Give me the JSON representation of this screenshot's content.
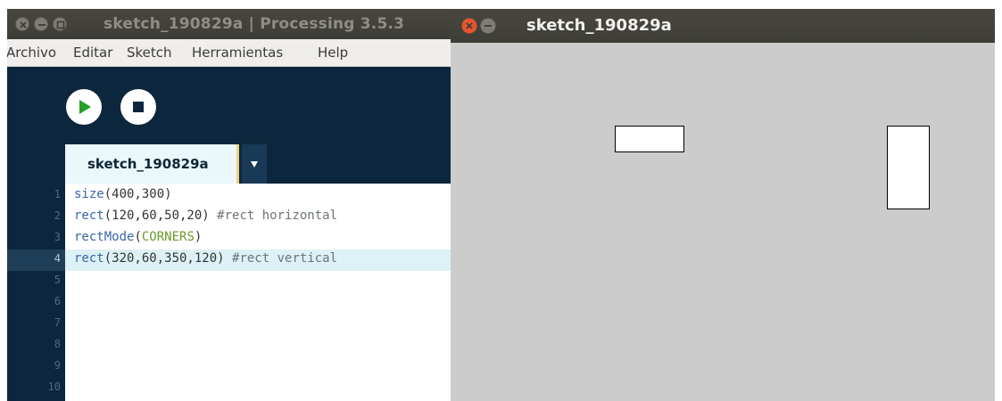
{
  "ide": {
    "title": "sketch_190829a | Processing 3.5.3",
    "menu": [
      "Archivo",
      "Editar",
      "Sketch",
      "Herramientas",
      "Help"
    ],
    "tab_label": "sketch_190829a",
    "tab_menu_glyph": "▾",
    "line_numbers": [
      "1",
      "2",
      "3",
      "4",
      "5",
      "6",
      "7",
      "8",
      "9",
      "10"
    ],
    "current_line": 4,
    "code": [
      [
        {
          "t": "size",
          "c": "kw"
        },
        {
          "t": "(400,300)",
          "c": "num"
        }
      ],
      [
        {
          "t": "rect",
          "c": "kw"
        },
        {
          "t": "(120,60,50,20) ",
          "c": "num"
        },
        {
          "t": "#rect horizontal",
          "c": "cmt"
        }
      ],
      [
        {
          "t": "rectMode",
          "c": "kw"
        },
        {
          "t": "(",
          "c": "num"
        },
        {
          "t": "CORNERS",
          "c": "const"
        },
        {
          "t": ")",
          "c": "num"
        }
      ],
      [
        {
          "t": "rect",
          "c": "kw"
        },
        {
          "t": "(320,60,350,120) ",
          "c": "num"
        },
        {
          "t": "#rect vertical",
          "c": "cmt"
        }
      ]
    ],
    "icons": {
      "close": "close-icon",
      "minimize": "minimize-icon",
      "maximize": "maximize-icon",
      "run": "play-icon",
      "stop": "stop-icon",
      "tab_menu": "chevron-down-icon"
    }
  },
  "sketch_window": {
    "title": "sketch_190829a",
    "canvas_bg": "#cccccc",
    "shapes": [
      {
        "name": "horizontal-rect",
        "fill": "#ffffff",
        "stroke": "#000000"
      },
      {
        "name": "vertical-rect",
        "fill": "#ffffff",
        "stroke": "#000000"
      }
    ]
  },
  "colors": {
    "run_green": "#27a026",
    "editor_dark": "#0c263d",
    "close_orange": "#e4572c"
  }
}
